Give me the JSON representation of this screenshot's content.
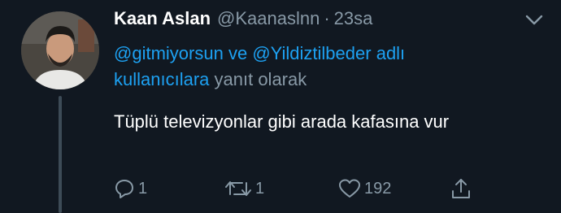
{
  "tweet": {
    "author_name": "Kaan Aslan",
    "handle": "@Kaanaslnn",
    "separator": "·",
    "time": "23sa",
    "reply_context": {
      "mention_1": "@gitmiyorsun",
      "connector": "ve",
      "mention_2": "@Yildiztilbeder",
      "word_adli": "adlı",
      "word_kullanicilara": "kullanıcılara",
      "suffix": "yanıt olarak"
    },
    "text": "Tüplü televizyonlar gibi arada kafasına vur",
    "stats": {
      "replies": "1",
      "retweets": "1",
      "likes": "192"
    }
  },
  "colors": {
    "background": "#111821",
    "secondary_text": "#8899a6",
    "link": "#1da1f2",
    "thread_line": "#3d4b57"
  },
  "icons": {
    "caret": "chevron-down-icon",
    "reply": "reply-bubble-icon",
    "retweet": "retweet-icon",
    "like": "heart-icon",
    "share": "share-icon"
  }
}
